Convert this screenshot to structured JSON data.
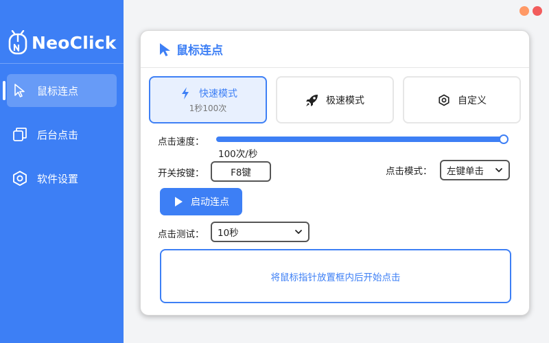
{
  "app": {
    "name": "NeoClick"
  },
  "colors": {
    "accent": "#3d7ff5",
    "sidebar": "#3d7ff5",
    "close": "#f25c5c",
    "minimize": "#ff9966"
  },
  "sidebar": {
    "items": [
      {
        "label": "鼠标连点",
        "icon": "cursor-icon",
        "active": true
      },
      {
        "label": "后台点击",
        "icon": "window-copy-icon",
        "active": false
      },
      {
        "label": "软件设置",
        "icon": "hexagon-settings-icon",
        "active": false
      }
    ]
  },
  "panel": {
    "title": "鼠标连点",
    "modes": [
      {
        "label": "快速模式",
        "sub": "1秒100次",
        "icon": "bolt-icon",
        "selected": true
      },
      {
        "label": "极速模式",
        "sub": "",
        "icon": "rocket-icon",
        "selected": false
      },
      {
        "label": "自定义",
        "sub": "",
        "icon": "hexagon-icon",
        "selected": false
      }
    ],
    "speed": {
      "label": "点击速度：",
      "value_text": "100次/秒",
      "level": 1.0
    },
    "hotkey": {
      "label": "开关按键：",
      "value": "F8键"
    },
    "click_mode": {
      "label": "点击模式：",
      "value": "左键单击"
    },
    "start_button": {
      "label": "启动连点"
    },
    "test": {
      "label": "点击测试：",
      "value": "10秒"
    },
    "test_area": {
      "hint": "将鼠标指针放置框内后开始点击"
    }
  }
}
